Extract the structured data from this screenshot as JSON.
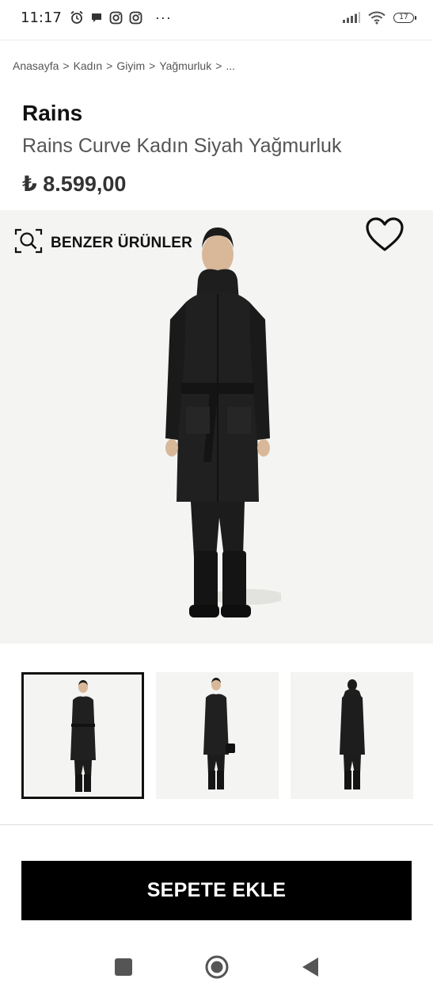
{
  "status_bar": {
    "time": "11:17",
    "battery": "17",
    "more": "···"
  },
  "breadcrumb": {
    "items": [
      "Anasayfa",
      "Kadın",
      "Giyim",
      "Yağmurluk",
      "..."
    ],
    "separator": ">"
  },
  "product": {
    "brand": "Rains",
    "name": "Rains Curve Kadın Siyah Yağmurluk",
    "price": "₺ 8.599,00"
  },
  "hero": {
    "similar_label": "BENZER ÜRÜNLER"
  },
  "actions": {
    "add_to_cart": "SEPETE EKLE"
  },
  "thumbnails": {
    "count": 3,
    "selected_index": 0
  },
  "icons": {
    "similar": "visual-search-icon",
    "favorite": "heart-icon",
    "nav_recents": "square-icon",
    "nav_home": "circle-icon",
    "nav_back": "triangle-back-icon"
  },
  "colors": {
    "button_bg": "#000000",
    "image_bg": "#f4f4f2"
  }
}
